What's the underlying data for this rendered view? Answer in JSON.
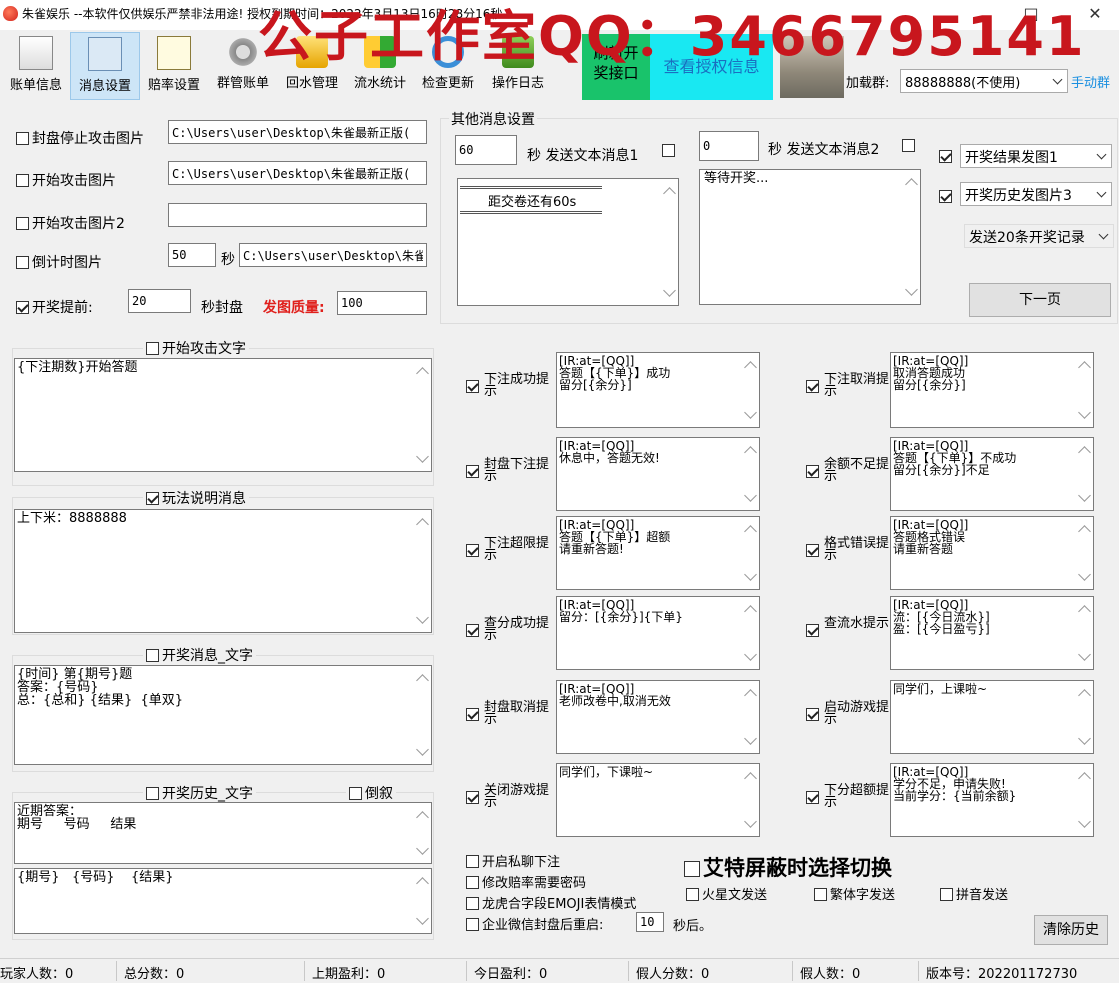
{
  "window": {
    "title": "朱雀娱乐 --本软件仅供娱乐严禁非法用途!          授权到期时间：2022年3月13日16时28分16秒",
    "watermark": "公子工作室QQ：3466795141"
  },
  "toolbar": {
    "items": [
      {
        "label": "账单信息",
        "icon": "bill-icon"
      },
      {
        "label": "消息设置",
        "icon": "mail-icon"
      },
      {
        "label": "赔率设置",
        "icon": "edit-icon"
      },
      {
        "label": "群管账单",
        "icon": "gear-icon"
      },
      {
        "label": "回水管理",
        "icon": "payback-icon"
      },
      {
        "label": "流水统计",
        "icon": "flow-icon"
      },
      {
        "label": "检查更新",
        "icon": "update-icon"
      },
      {
        "label": "操作日志",
        "icon": "log-icon"
      }
    ],
    "green_button": "刷新开奖接口",
    "cyan_button": "查看授权信息",
    "group_label": "加载群:",
    "group_value": "88888888(不使用)",
    "manual_label": "手动群"
  },
  "left": {
    "stop_img_label": "封盘停止攻击图片",
    "stop_img_path": "C:\\Users\\user\\Desktop\\朱雀最新正版(",
    "start_img_label": "开始攻击图片",
    "start_img_path": "C:\\Users\\user\\Desktop\\朱雀最新正版(",
    "start_img2_label": "开始攻击图片2",
    "start_img2_path": "",
    "countdown_label": "倒计时图片",
    "countdown_sec": "50",
    "sec_unit": "秒",
    "countdown_path": "C:\\Users\\user\\Desktop\\朱雀",
    "lottery_ahead_label": "开奖提前:",
    "lottery_ahead_val": "20",
    "seal_label": "秒封盘",
    "quality_label": "发图质量:",
    "quality_val": "100",
    "attack_text_label": "开始攻击文字",
    "attack_text": "{下注期数}开始答题",
    "rules_label": "玩法说明消息",
    "rules_text": "上下米：8888888",
    "lottery_msg_label": "开奖消息_文字",
    "lottery_msg_text": "{时间} 第{期号}题\n答案：{号码}\n总：{总和} {结果}  {单双}",
    "history_label": "开奖历史_文字",
    "reverse_label": "倒叙",
    "history_header": "近期答案：\n期号     号码     结果",
    "history_row": "{期号}   {号码}    {结果}"
  },
  "other": {
    "group_title": "其他消息设置",
    "msg1_sec": "60",
    "msg1_label": "秒 发送文本消息1",
    "msg2_sec": "0",
    "msg2_label": "秒 发送文本消息2",
    "msg1_text": "距交卷还有60s",
    "msg2_text": "等待开奖...",
    "result_img": "开奖结果发图1",
    "history_img": "开奖历史发图片3",
    "send_records": "发送20条开奖记录",
    "next_page": "下一页"
  },
  "prompts": [
    {
      "label": "下注成功提示",
      "text": "[IR:at=[QQ]]\n答题【{下单}】成功\n留分[{余分}]"
    },
    {
      "label": "下注取消提示",
      "text": "[IR:at=[QQ]]\n取消答题成功\n留分[{余分}]"
    },
    {
      "label": "封盘下注提示",
      "text": "[IR:at=[QQ]]\n休息中，答题无效!"
    },
    {
      "label": "余额不足提示",
      "text": "[IR:at=[QQ]]\n答题【{下单}】不成功\n留分[{余分}]不足"
    },
    {
      "label": "下注超限提示",
      "text": "[IR:at=[QQ]]\n答题【{下单}】超额\n请重新答题!"
    },
    {
      "label": "格式错误提示",
      "text": "[IR:at=[QQ]]\n答题格式错误\n请重新答题"
    },
    {
      "label": "查分成功提示",
      "text": "[IR:at=[QQ]]\n留分：[{余分}]{下单}"
    },
    {
      "label": "查流水提示",
      "text": "[IR:at=[QQ]]\n流：[{今日流水}]\n盈：[{今日盈亏}]"
    },
    {
      "label": "封盘取消提示",
      "text": "[IR:at=[QQ]]\n老师改卷中,取消无效"
    },
    {
      "label": "启动游戏提示",
      "text": "同学们，上课啦~"
    },
    {
      "label": "关闭游戏提示",
      "text": "同学们，下课啦~"
    },
    {
      "label": "下分超额提示",
      "text": "[IR:at=[QQ]]\n学分不足，申请失败!\n当前学分：{当前余额}"
    }
  ],
  "bottom": {
    "private_chat": "开启私聊下注",
    "modify_odds": "修改赔率需要密码",
    "dragon_mode": "龙虎合字段EMOJI表情模式",
    "wechat_restart": "企业微信封盘后重启:",
    "restart_sec": "10",
    "restart_unit": "秒后。",
    "ate_title": "艾特屏蔽时选择切换",
    "mars": "火星文发送",
    "trad": "繁体字发送",
    "pinyin": "拼音发送",
    "clear": "清除历史"
  },
  "status": {
    "players": "玩家人数：0",
    "total": "总分数：0",
    "last_profit": "上期盈利：0",
    "today_profit": "今日盈利：0",
    "fake_score": "假人分数：0",
    "fake_count": "假人数：0",
    "version": "版本号：202201172730"
  }
}
